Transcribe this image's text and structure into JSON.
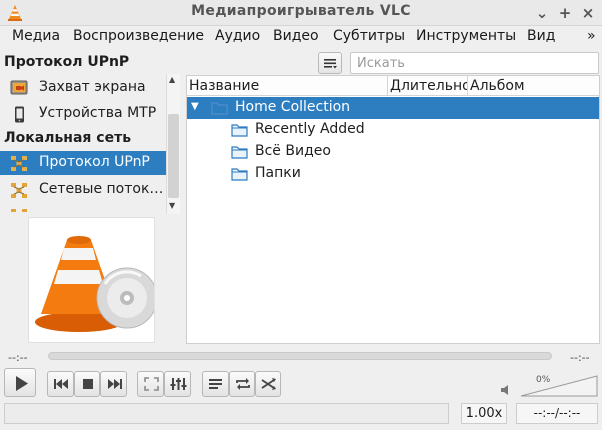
{
  "window": {
    "title": "Медиапроигрыватель VLC",
    "controls": [
      "minimize-icon",
      "maximize-icon",
      "close-icon"
    ]
  },
  "menu": [
    "Медиа",
    "Воспроизведение",
    "Аудио",
    "Видео",
    "Субтитры",
    "Инструменты",
    "Вид",
    "»"
  ],
  "sidebar": {
    "section1_header": "Протокол UPnP",
    "section1_items": [
      {
        "label": "Захват экрана",
        "icon": "screen-capture-icon"
      },
      {
        "label": "Устройства MTP",
        "icon": "mtp-device-icon"
      }
    ],
    "section2_header": "Локальная сеть",
    "section2_items": [
      {
        "label": "Протокол UPnP",
        "icon": "network-icon",
        "selected": true
      },
      {
        "label": "Сетевые поток…",
        "icon": "network-icon"
      },
      {
        "label": "",
        "icon": "network-icon"
      }
    ]
  },
  "playlist_toolbar": {
    "view_icon": "playlist-view-icon",
    "search_placeholder": "Искать"
  },
  "playlist": {
    "columns": [
      "Название",
      "Длительность",
      "Альбом"
    ],
    "rows": [
      {
        "label": "Home Collection",
        "level": 0,
        "expanded": true,
        "selected": true
      },
      {
        "label": "Recently Added",
        "level": 1
      },
      {
        "label": "Всё Видео",
        "level": 1
      },
      {
        "label": "Папки",
        "level": 1
      }
    ]
  },
  "seek": {
    "time_left": "--:--",
    "time_right": "--:--",
    "position": 0
  },
  "controls": {
    "buttons": [
      "play-icon",
      "previous-icon",
      "stop-icon",
      "next-icon",
      "fullscreen-icon",
      "extended-settings-icon",
      "playlist-icon",
      "loop-icon",
      "shuffle-icon"
    ]
  },
  "volume": {
    "percent_label": "0%",
    "level": 0,
    "icon": "speaker-muted-icon"
  },
  "statusbar": {
    "speed": "1.00x",
    "elapsed": "--:--/--:--"
  },
  "colors": {
    "selection": "#2d7ec1",
    "cone_orange": "#f07a12"
  }
}
